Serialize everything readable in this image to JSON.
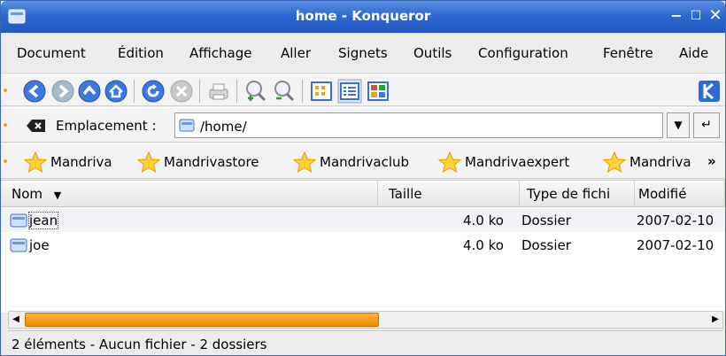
{
  "window": {
    "title": "home - Konqueror"
  },
  "menu": {
    "items": [
      {
        "key": "document",
        "label": "Document"
      },
      {
        "key": "edition",
        "label": "Édition"
      },
      {
        "key": "affichage",
        "label": "Affichage"
      },
      {
        "key": "aller",
        "label": "Aller"
      },
      {
        "key": "signets",
        "label": "Signets"
      },
      {
        "key": "outils",
        "label": "Outils"
      },
      {
        "key": "configuration",
        "label": "Configuration"
      },
      {
        "key": "fenetre",
        "label": "Fenêtre"
      },
      {
        "key": "aide",
        "label": "Aide"
      }
    ]
  },
  "location": {
    "label": "Emplacement :",
    "value": "/home/"
  },
  "bookmarks": [
    "Mandriva",
    "Mandrivastore",
    "Mandrivaclub",
    "Mandrivaexpert",
    "Mandriva"
  ],
  "bookmarks_more": "»",
  "columns": {
    "name": "Nom",
    "size": "Taille",
    "type": "Type de fichi",
    "modified": "Modifié"
  },
  "files": [
    {
      "name": "jean",
      "size": "4.0 ko",
      "type": "Dossier",
      "modified": "2007-02-10"
    },
    {
      "name": "joe",
      "size": "4.0 ko",
      "type": "Dossier",
      "modified": "2007-02-10"
    }
  ],
  "status": "2 éléments - Aucun fichier - 2 dossiers",
  "colors": {
    "titlebar": "#2f69d2",
    "accent": "#f08a00",
    "grip": "#f4a70c"
  },
  "icons": [
    "back-icon",
    "forward-icon",
    "up-icon",
    "home-icon",
    "reload-icon",
    "stop-icon",
    "print-icon",
    "zoom-in-icon",
    "zoom-out-icon",
    "icon-view-icon",
    "list-view-icon",
    "multicolumn-view-icon",
    "kde-logo-icon",
    "folder-icon",
    "star-icon"
  ]
}
